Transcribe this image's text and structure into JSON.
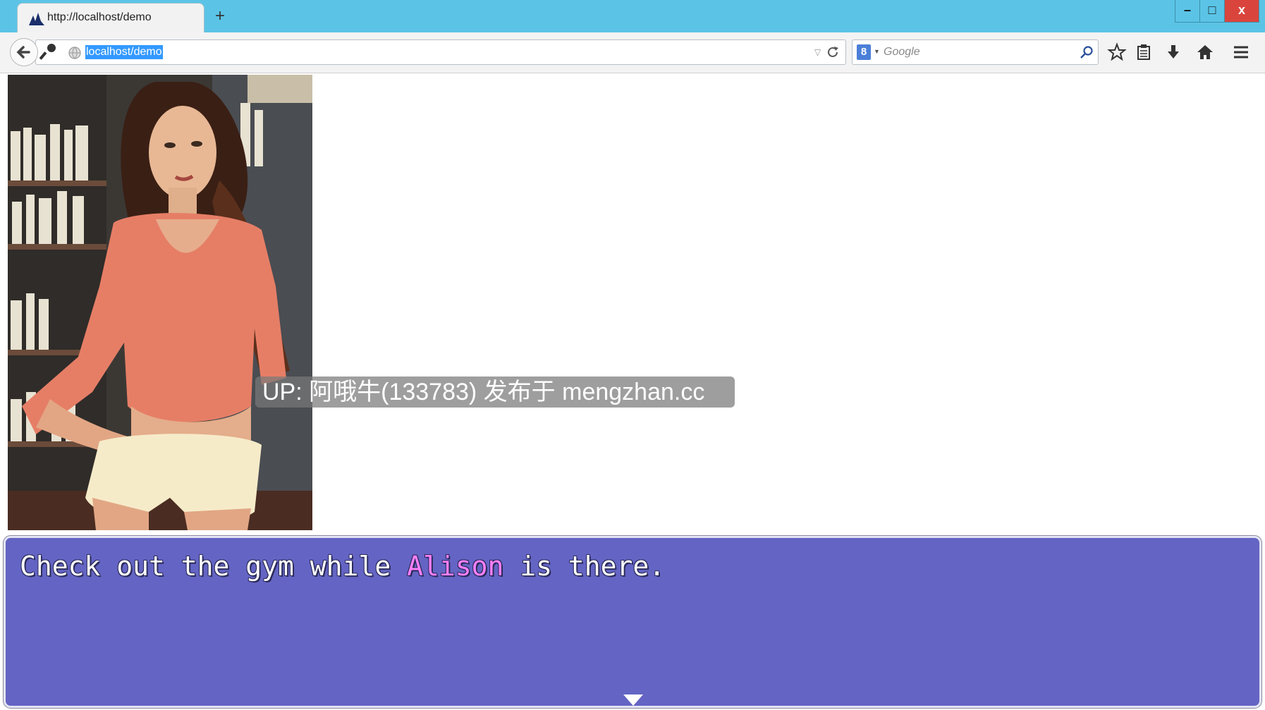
{
  "browser": {
    "tab_title": "http://localhost/demo",
    "new_tab_label": "+",
    "url": "localhost/demo",
    "search_placeholder": "Google",
    "window_controls": {
      "minimize": "–",
      "maximize": "□",
      "close": "x"
    },
    "icons": [
      "back-arrow-icon",
      "key-icon",
      "globe-icon",
      "reload-icon",
      "google-icon",
      "search-icon",
      "star-icon",
      "clipboard-icon",
      "download-icon",
      "home-icon",
      "menu-icon"
    ]
  },
  "watermark": "UP: 阿哦牛(133783) 发布于 mengzhan.cc",
  "message": {
    "before": "Check out the gym while ",
    "name": "Alison",
    "after": " is there.",
    "name_color": "#ff80ff",
    "window_color": "#6464c4"
  },
  "colors": {
    "titlebar": "#5bc4e6",
    "close_button": "#d9453c",
    "url_selection": "#3399ff"
  }
}
